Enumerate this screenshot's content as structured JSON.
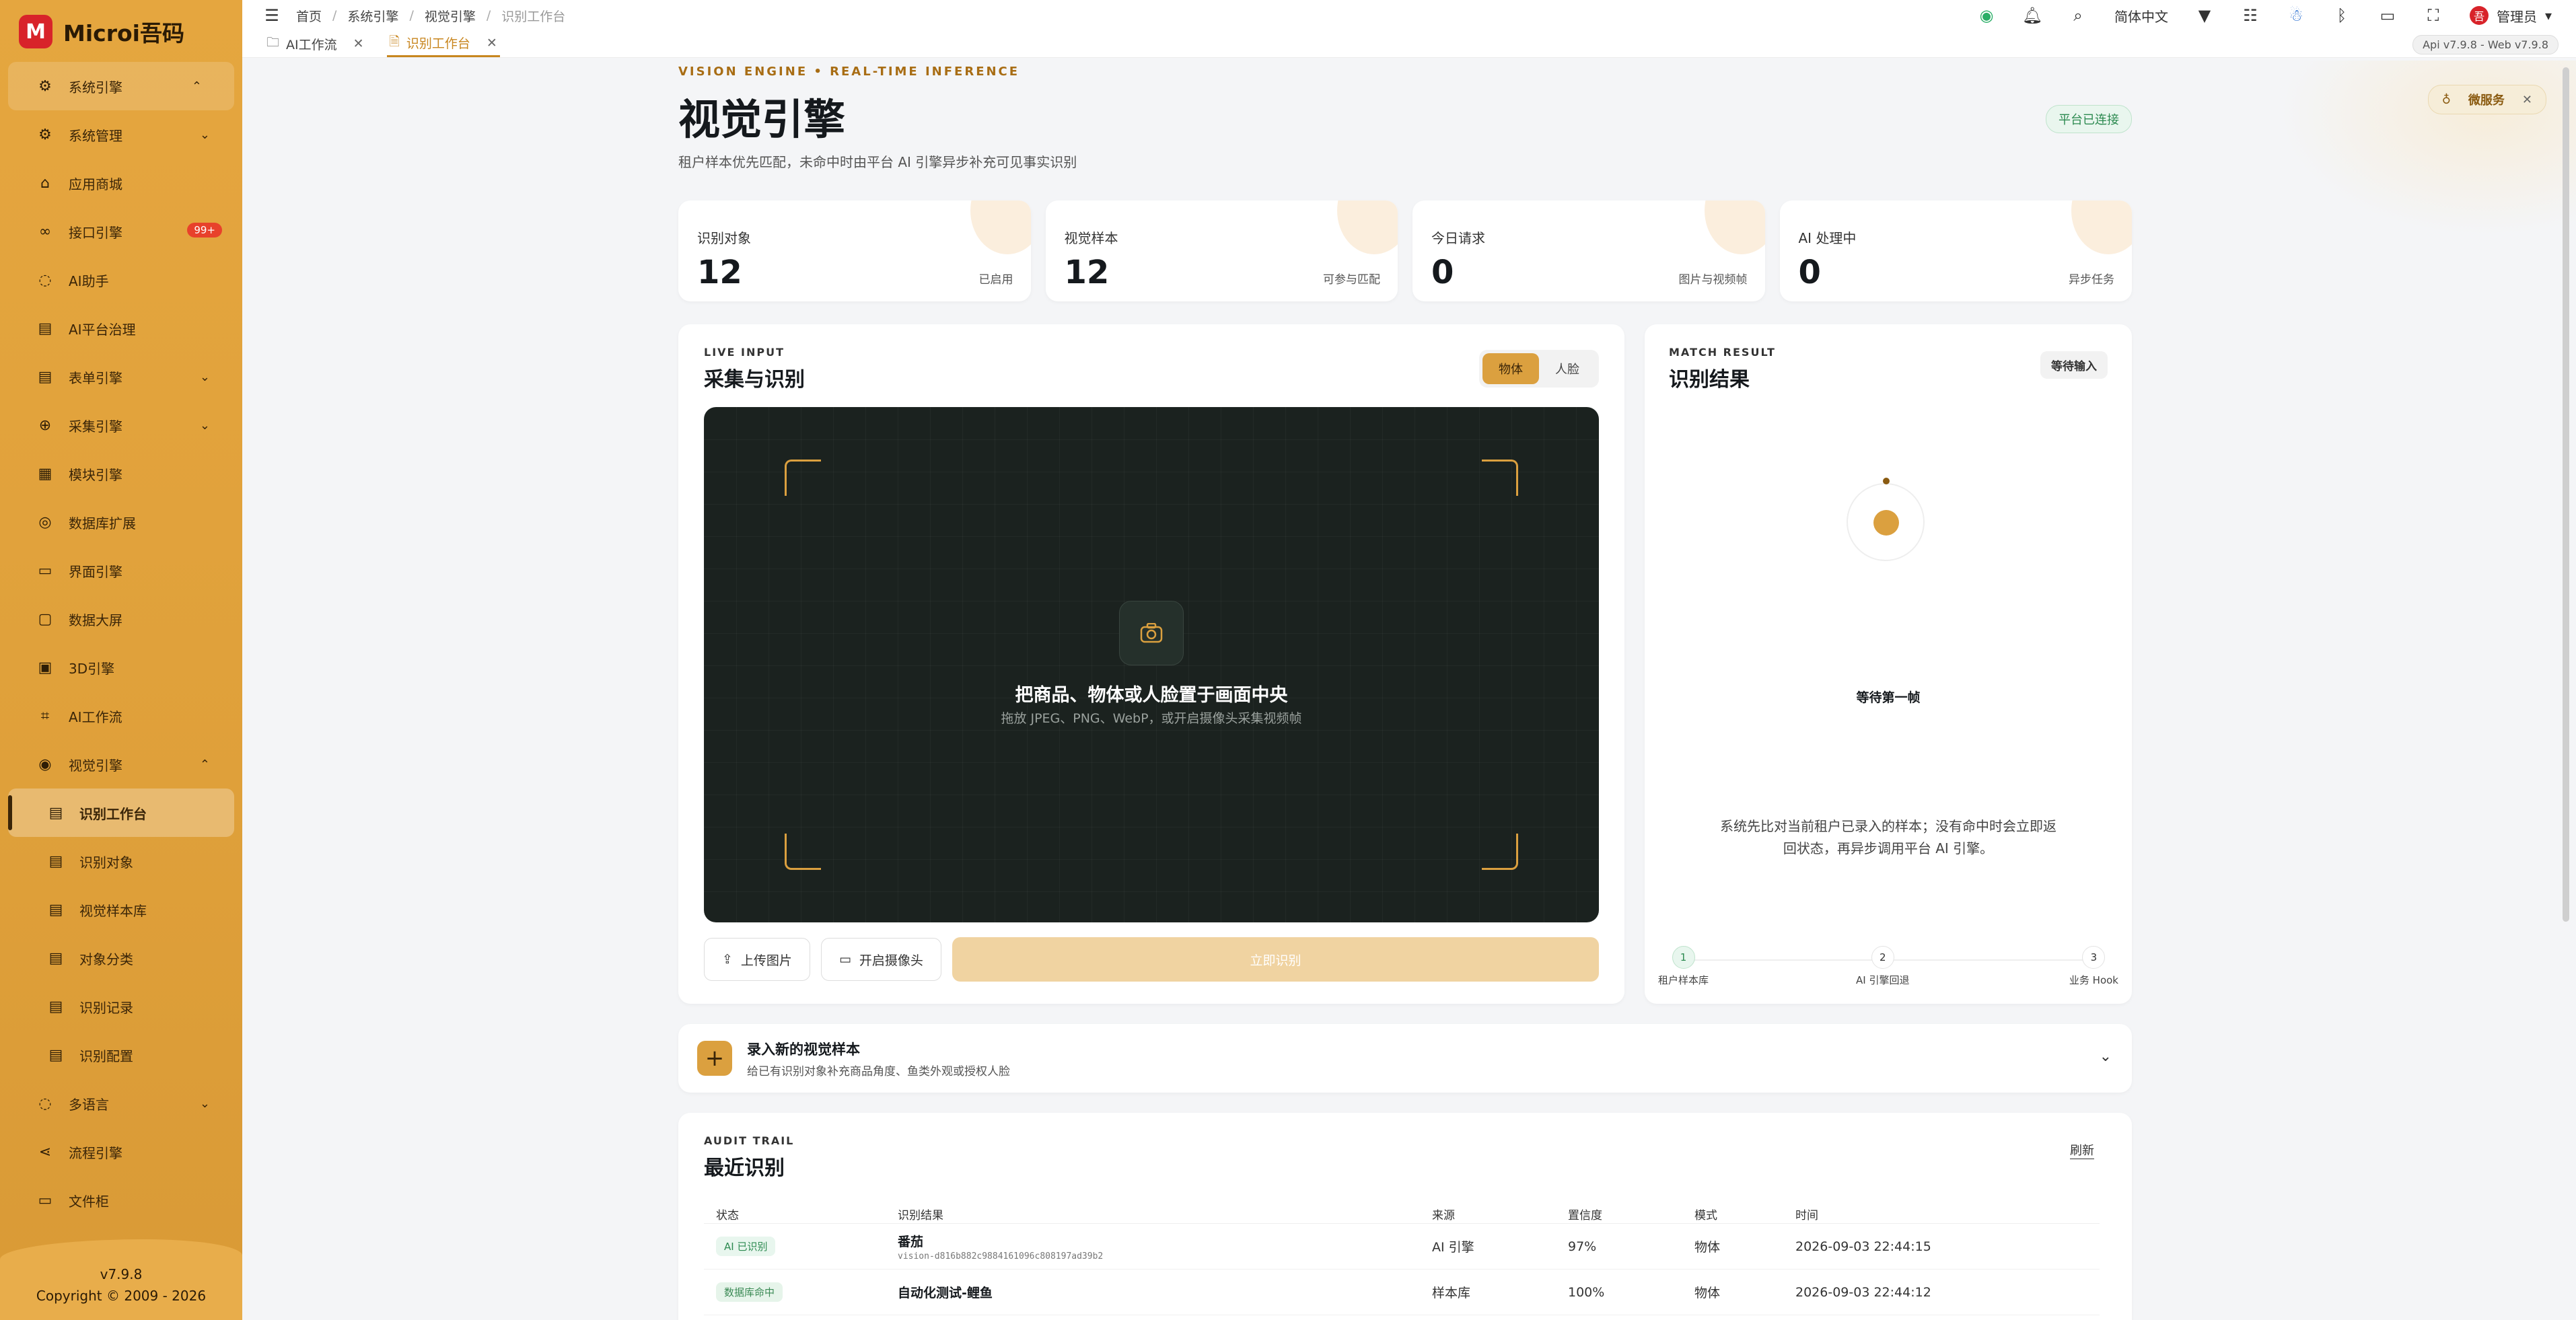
{
  "app": {
    "brand": "Microi吾码",
    "version": "v7.9.8",
    "copyright": "Copyright © 2009 - 2026"
  },
  "sidebar": {
    "items": [
      {
        "label": "系统引擎",
        "icon": "gear-icon",
        "chevron": "up"
      },
      {
        "label": "系统管理",
        "icon": "settings-icon",
        "chevron": "down"
      },
      {
        "label": "应用商城",
        "icon": "shop-icon"
      },
      {
        "label": "接口引擎",
        "icon": "link-icon",
        "badge": "99+"
      },
      {
        "label": "AI助手",
        "icon": "chat-icon"
      },
      {
        "label": "AI平台治理",
        "icon": "clipboard-icon"
      },
      {
        "label": "表单引擎",
        "icon": "form-icon",
        "chevron": "down"
      },
      {
        "label": "采集引擎",
        "icon": "collect-icon",
        "chevron": "down"
      },
      {
        "label": "模块引擎",
        "icon": "grid-icon"
      },
      {
        "label": "数据库扩展",
        "icon": "database-icon"
      },
      {
        "label": "界面引擎",
        "icon": "layout-icon"
      },
      {
        "label": "数据大屏",
        "icon": "screen-icon"
      },
      {
        "label": "3D引擎",
        "icon": "cube-icon"
      },
      {
        "label": "AI工作流",
        "icon": "flow-icon"
      },
      {
        "label": "视觉引擎",
        "icon": "eye-icon",
        "chevron": "up"
      },
      {
        "label": "识别工作台",
        "icon": "clipboard-icon",
        "active": true
      },
      {
        "label": "识别对象",
        "icon": "clipboard-icon"
      },
      {
        "label": "视觉样本库",
        "icon": "clipboard-icon"
      },
      {
        "label": "对象分类",
        "icon": "clipboard-icon"
      },
      {
        "label": "识别记录",
        "icon": "clipboard-icon"
      },
      {
        "label": "识别配置",
        "icon": "clipboard-icon"
      },
      {
        "label": "多语言",
        "icon": "chat-icon",
        "chevron": "down"
      },
      {
        "label": "流程引擎",
        "icon": "share-icon"
      },
      {
        "label": "文件柜",
        "icon": "folder-icon"
      }
    ]
  },
  "topbar": {
    "breadcrumb": [
      "首页",
      "系统引擎",
      "视觉引擎",
      "识别工作台"
    ],
    "language": "简体中文",
    "user": "管理员"
  },
  "tabs": [
    {
      "label": "AI工作流"
    },
    {
      "label": "识别工作台"
    }
  ],
  "version_pill": "Api v7.9.8 - Web v7.9.8",
  "wm_pill": "微服务",
  "page": {
    "eyebrow": "VISION ENGINE • REAL-TIME INFERENCE",
    "title": "视觉引擎",
    "subtitle": "租户样本优先匹配，未命中时由平台 AI 引擎异步补充可见事实识别",
    "connection": "平台已连接"
  },
  "stats": [
    {
      "label": "识别对象",
      "value": "12",
      "note": "已启用"
    },
    {
      "label": "视觉样本",
      "value": "12",
      "note": "可参与匹配"
    },
    {
      "label": "今日请求",
      "value": "0",
      "note": "图片与视频帧"
    },
    {
      "label": "AI 处理中",
      "value": "0",
      "note": "异步任务"
    }
  ],
  "capture": {
    "eyebrow": "LIVE INPUT",
    "title": "采集与识别",
    "modes": [
      "物体",
      "人脸"
    ],
    "selected_mode": "物体",
    "hint_title": "把商品、物体或人脸置于画面中央",
    "hint_sub": "拖放 JPEG、PNG、WebP，或开启摄像头采集视频帧",
    "upload": "上传图片",
    "camera": "开启摄像头",
    "recognize": "立即识别"
  },
  "result": {
    "eyebrow": "MATCH RESULT",
    "title": "识别结果",
    "status": "等待输入",
    "wait_title": "等待第一帧",
    "desc": "系统先比对当前租户已录入的样本；没有命中时会立即返回状态，再异步调用平台 AI 引擎。",
    "steps": [
      {
        "n": "1",
        "label": "租户样本库"
      },
      {
        "n": "2",
        "label": "AI 引擎回退"
      },
      {
        "n": "3",
        "label": "业务 Hook"
      }
    ]
  },
  "sample": {
    "title": "录入新的视觉样本",
    "desc": "给已有识别对象补充商品角度、鱼类外观或授权人脸"
  },
  "audit": {
    "eyebrow": "AUDIT TRAIL",
    "title": "最近识别",
    "refresh": "刷新",
    "columns": [
      "状态",
      "识别结果",
      "来源",
      "置信度",
      "模式",
      "时间"
    ],
    "rows": [
      {
        "status": "AI 已识别",
        "name": "番茄",
        "id": "vision-d816b882c9884161096c808197ad39b2",
        "source": "AI 引擎",
        "conf": "97%",
        "mode": "物体",
        "time": "2026-09-03 22:44:15"
      },
      {
        "status": "数据库命中",
        "name": "自动化测试-鲤鱼",
        "id": "",
        "source": "样本库",
        "conf": "100%",
        "mode": "物体",
        "time": "2026-09-03 22:44:12"
      }
    ]
  },
  "colors": {
    "accent": "#dba03f",
    "sidebar": "#e5a63f",
    "viewer": "#1b221f"
  }
}
